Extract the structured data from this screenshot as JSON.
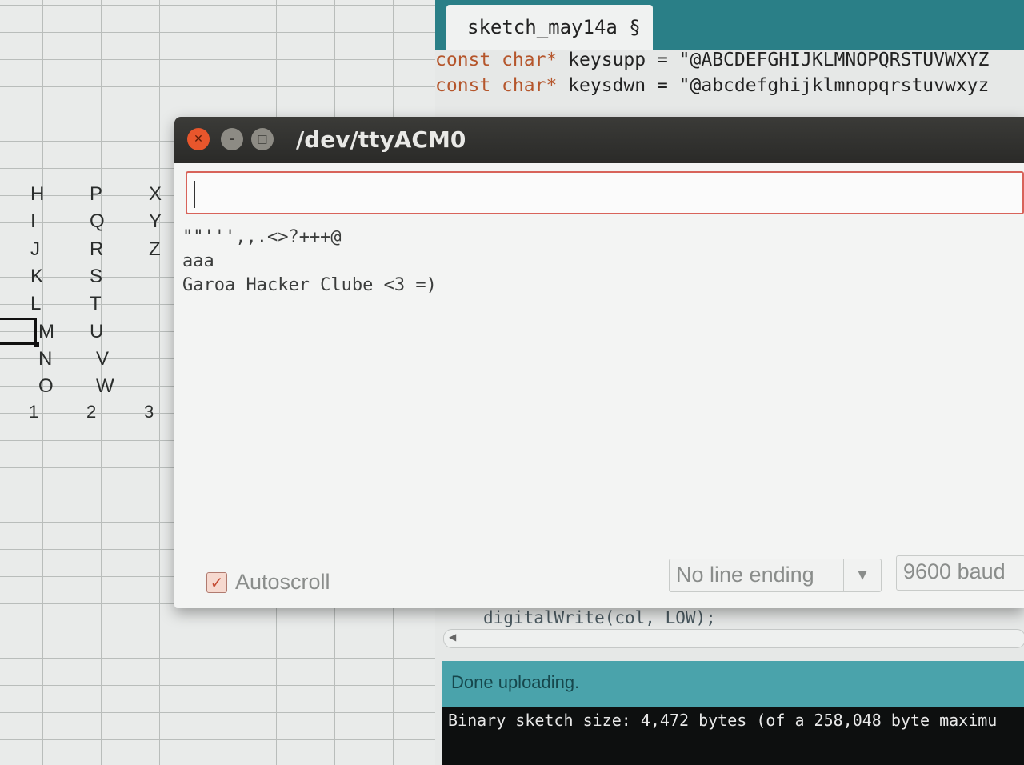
{
  "spreadsheet": {
    "columns": [
      [
        "H",
        "I",
        "J",
        "K",
        "L",
        "M",
        "N",
        "O"
      ],
      [
        "P",
        "Q",
        "R",
        "S",
        "T",
        "U",
        "V",
        "W"
      ],
      [
        "X",
        "Y",
        "Z"
      ]
    ],
    "column_numbers": [
      "1",
      "2",
      "3"
    ]
  },
  "editor": {
    "tab_label": "sketch_may14a §",
    "code_lines": [
      {
        "keyword": "const char*",
        "rest": " keysupp = \"@ABCDEFGHIJKLMNOPQRSTUVWXYZ"
      },
      {
        "keyword": "const char*",
        "rest": " keysdwn = \"@abcdefghijklmnopqrstuvwxyz"
      }
    ],
    "partial_code": "digitalWrite(col, LOW);",
    "status": "Done uploading.",
    "console": "Binary sketch size: 4,472 bytes (of a 258,048 byte maximu"
  },
  "serial_monitor": {
    "title": "/dev/ttyACM0",
    "input_value": "",
    "output_lines": [
      "\"\"''',,.<>?+++@",
      "aaa",
      "Garoa Hacker Clube <3 =)"
    ],
    "autoscroll_label": "Autoscroll",
    "autoscroll_checked": true,
    "line_ending": "No line ending",
    "baud": "9600 baud"
  },
  "colors": {
    "editor_accent": "#2a7f87",
    "status_bar": "#4aa3ab",
    "close_button": "#e8562c",
    "input_border": "#d8635a"
  }
}
